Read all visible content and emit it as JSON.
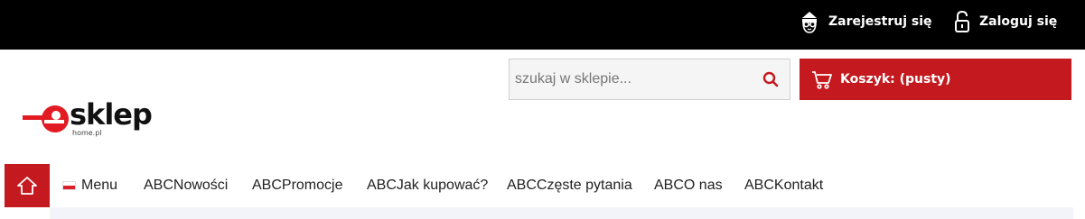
{
  "topbar": {
    "register_label": "Zarejestruj się",
    "login_label": "Zaloguj się",
    "register_icon": "user-avatar-icon",
    "login_icon": "padlock-icon"
  },
  "logo": {
    "main_text": "sklep",
    "sub_text": "home.pl",
    "letter": "e"
  },
  "search": {
    "placeholder": "szukaj w sklepie...",
    "value": "",
    "icon": "search-icon"
  },
  "cart": {
    "label": "Koszyk: (pusty)",
    "icon": "cart-icon"
  },
  "nav": {
    "home_icon": "home-icon",
    "menu_label": "Menu",
    "items": [
      "ABCNowości",
      "ABCPromocje",
      "ABCJak kupować?",
      "ABCCzęste pytania",
      "ABCO nas",
      "ABCKontakt"
    ]
  },
  "colors": {
    "accent": "#c4191f",
    "topbar": "#000000",
    "text": "#222222"
  }
}
